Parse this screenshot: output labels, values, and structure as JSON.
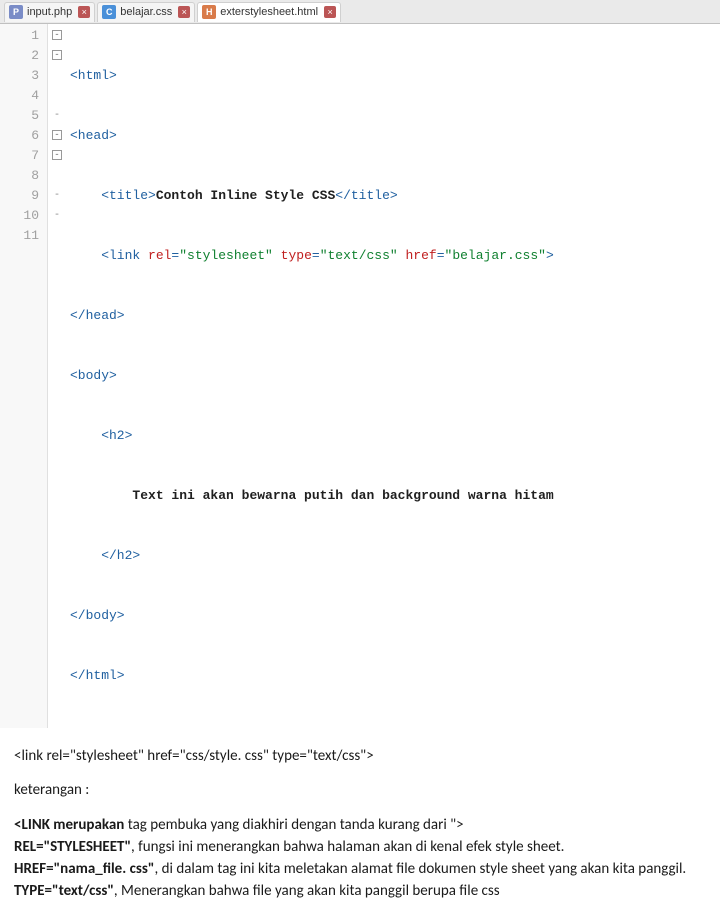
{
  "tabs": [
    {
      "label": "input.php",
      "iconClass": "php-icon",
      "iconText": "P",
      "active": false
    },
    {
      "label": "belajar.css",
      "iconClass": "css-icon",
      "iconText": "C",
      "active": false
    },
    {
      "label": "exterstylesheet.html",
      "iconClass": "html-icon",
      "iconText": "H",
      "active": true
    }
  ],
  "lineNumbers": [
    "1",
    "2",
    "3",
    "4",
    "5",
    "6",
    "7",
    "8",
    "9",
    "10",
    "11"
  ],
  "fold": [
    "-",
    "-",
    "",
    "",
    "-",
    "-",
    "-",
    "",
    "-",
    "-",
    ""
  ],
  "codeLines": {
    "l1": {
      "a": "<html>"
    },
    "l2": {
      "a": "<head>"
    },
    "l3": {
      "a": "    <title>",
      "b": "Contoh Inline Style CSS",
      "c": "</title>"
    },
    "l4": {
      "a": "    <link ",
      "b": "rel",
      "c": "=",
      "d": "\"stylesheet\"",
      "e": " type",
      "f": "=",
      "g": "\"text/css\"",
      "h": " href",
      "i": "=",
      "j": "\"belajar.css\"",
      "k": ">"
    },
    "l5": {
      "a": "</head>"
    },
    "l6": {
      "a": "<body>"
    },
    "l7": {
      "a": "    <h2>"
    },
    "l8": {
      "a": "        ",
      "b": "Text ini akan bewarna putih dan background warna hitam"
    },
    "l9": {
      "a": "    </h2>"
    },
    "l10": {
      "a": "</body>"
    },
    "l11": {
      "a": "</html>"
    }
  },
  "explain": {
    "codeLine": "<link rel=\"stylesheet\" href=\"css/style. css\" type=\"text/css\">",
    "ket": "keterangan :",
    "p1a": "<LINK merupakan",
    "p1b": " tag pembuka yang diakhiri dengan tanda kurang dari \">",
    "p2a": "REL=\"STYLESHEET\"",
    "p2b": ", fungsi ini menerangkan bahwa halaman akan di kenal efek style sheet.",
    "p3a": "HREF=\"nama_file. css\"",
    "p3b": ", di dalam tag ini kita meletakan alamat file dokumen style sheet yang akan kita panggil.",
    "p4a": "TYPE=\"text/css\"",
    "p4b": ", Menerangkan bahwa file yang akan kita panggil berupa file css"
  }
}
